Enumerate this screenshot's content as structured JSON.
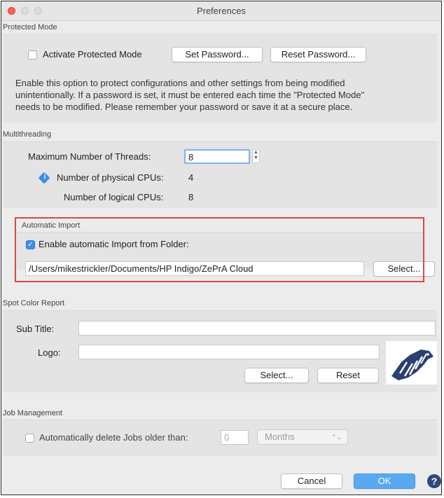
{
  "window": {
    "title": "Preferences"
  },
  "protected_mode": {
    "header": "Protected Mode",
    "checkbox_label": "Activate Protected Mode",
    "checked": false,
    "set_password": "Set Password...",
    "reset_password": "Reset Password...",
    "description_lines": [
      "Enable this option to protect configurations and other settings from being modified",
      "unintentionally. If a password is set, it must be entered each time  the \"Protected Mode\"",
      "needs to be modified. Please remember your password or save it at a secure place."
    ]
  },
  "multithreading": {
    "header": "Multithreading",
    "max_threads_label": "Maximum Number of Threads:",
    "max_threads_value": "8",
    "physical_label": "Number of physical CPUs:",
    "physical_value": "4",
    "logical_label": "Number of logical CPUs:",
    "logical_value": "8"
  },
  "automatic_import": {
    "header": "Automatic Import",
    "checkbox_label": "Enable automatic Import from Folder:",
    "checked": true,
    "path": "/Users/mikestrickler/Documents/HP Indigo/ZePrA Cloud",
    "select": "Select...",
    "highlight_color": "#e0463d"
  },
  "spot_color_report": {
    "header": "Spot Color Report",
    "subtitle_label": "Sub Title:",
    "subtitle_value": "",
    "logo_label": "Logo:",
    "logo_value": "",
    "select": "Select...",
    "reset": "Reset"
  },
  "job_management": {
    "header": "Job Management",
    "checkbox_label": "Automatically delete Jobs older than:",
    "checked": false,
    "age_value": "0",
    "unit": "Months"
  },
  "footer": {
    "cancel": "Cancel",
    "ok": "OK",
    "help": "?"
  },
  "colors": {
    "accent": "#3b8ee8",
    "ok_button": "#59a8f0"
  }
}
